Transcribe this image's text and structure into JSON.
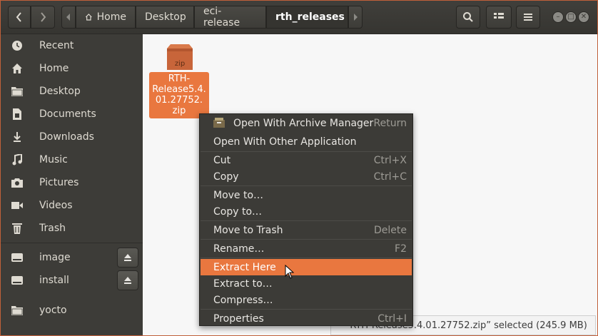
{
  "header": {
    "breadcrumbs": [
      "Home",
      "Desktop",
      "eci-release",
      "rth_releases"
    ],
    "back_icon": "chevron-left-icon",
    "forward_icon": "chevron-right-icon"
  },
  "sidebar": {
    "items": [
      {
        "label": "Recent",
        "icon": "clock-icon"
      },
      {
        "label": "Home",
        "icon": "home-icon"
      },
      {
        "label": "Desktop",
        "icon": "folder-icon"
      },
      {
        "label": "Documents",
        "icon": "document-icon"
      },
      {
        "label": "Downloads",
        "icon": "download-icon"
      },
      {
        "label": "Music",
        "icon": "music-icon"
      },
      {
        "label": "Pictures",
        "icon": "camera-icon"
      },
      {
        "label": "Videos",
        "icon": "video-icon"
      },
      {
        "label": "Trash",
        "icon": "trash-icon"
      },
      {
        "label": "image",
        "icon": "drive-icon"
      },
      {
        "label": "install",
        "icon": "drive-icon"
      },
      {
        "label": "yocto",
        "icon": "folder-icon"
      }
    ]
  },
  "file": {
    "icon_text": "zip",
    "name_lines": [
      "RTH-",
      "Release5.4.",
      "01.27752.",
      "zip"
    ]
  },
  "context_menu": {
    "items": [
      {
        "label": "Open With Archive Manager",
        "accel": "Return"
      },
      {
        "label": "Open With Other Application",
        "accel": ""
      },
      {
        "label": "Cut",
        "accel": "Ctrl+X"
      },
      {
        "label": "Copy",
        "accel": "Ctrl+C"
      },
      {
        "label": "Move to…",
        "accel": ""
      },
      {
        "label": "Copy to…",
        "accel": ""
      },
      {
        "label": "Move to Trash",
        "accel": "Delete"
      },
      {
        "label": "Rename…",
        "accel": "F2"
      },
      {
        "label": "Extract Here",
        "accel": ""
      },
      {
        "label": "Extract to…",
        "accel": ""
      },
      {
        "label": "Compress…",
        "accel": ""
      },
      {
        "label": "Properties",
        "accel": "Ctrl+I"
      }
    ],
    "highlighted_index": 8
  },
  "status": {
    "text": "“RTH-Release5.4.01.27752.zip” selected  (245.9 MB)"
  },
  "colors": {
    "accent": "#e9773f",
    "sidebar_bg": "#3d3c38",
    "header_bg": "#3c3b37"
  }
}
